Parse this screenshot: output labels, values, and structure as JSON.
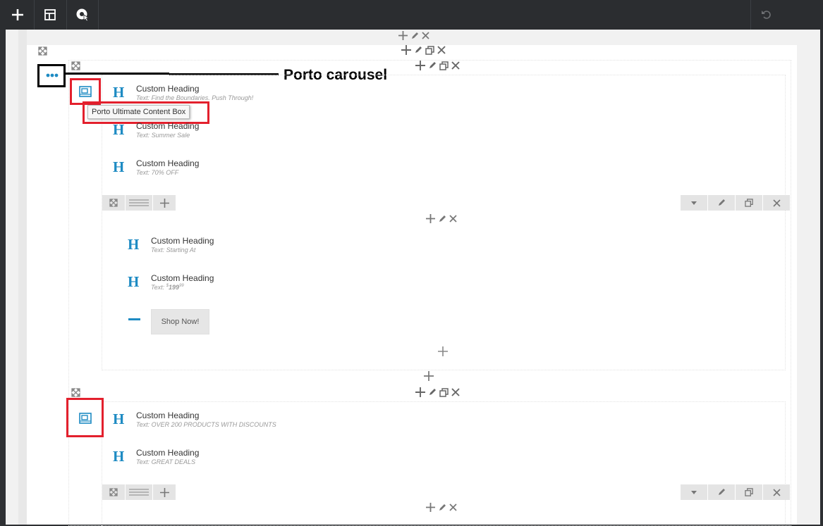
{
  "toolbar": {
    "add_icon": "plus-icon",
    "layout_icon": "layout-icon",
    "preview_icon": "preview-icon",
    "undo_icon": "undo-icon"
  },
  "annotation": {
    "callout_label": "Porto carousel",
    "tooltip": "Porto Ultimate Content Box",
    "highlight_color": "#e3202d"
  },
  "carousel": {
    "icon": "ellipsis-icon",
    "box1": {
      "headings": [
        {
          "title": "Custom Heading",
          "text": "Text: Find the Boundaries. Push Through!"
        },
        {
          "title": "Custom Heading",
          "text": "Text: Summer Sale"
        },
        {
          "title": "Custom Heading",
          "text": "Text: 70% OFF"
        }
      ],
      "inner": {
        "headings": [
          {
            "title": "Custom Heading",
            "text": "Text: Starting At"
          },
          {
            "title": "Custom Heading",
            "text_prefix": "Text: ",
            "currency": "$",
            "amount": "199",
            "cents": "99"
          }
        ],
        "button_label": "Shop Now!"
      }
    },
    "box2": {
      "headings": [
        {
          "title": "Custom Heading",
          "text": "Text: OVER 200 PRODUCTS WITH DISCOUNTS"
        },
        {
          "title": "Custom Heading",
          "text": "Text: GREAT DEALS"
        }
      ]
    }
  },
  "colors": {
    "accent": "#1e8bc3",
    "toolbar_bg": "#2b2d30"
  }
}
